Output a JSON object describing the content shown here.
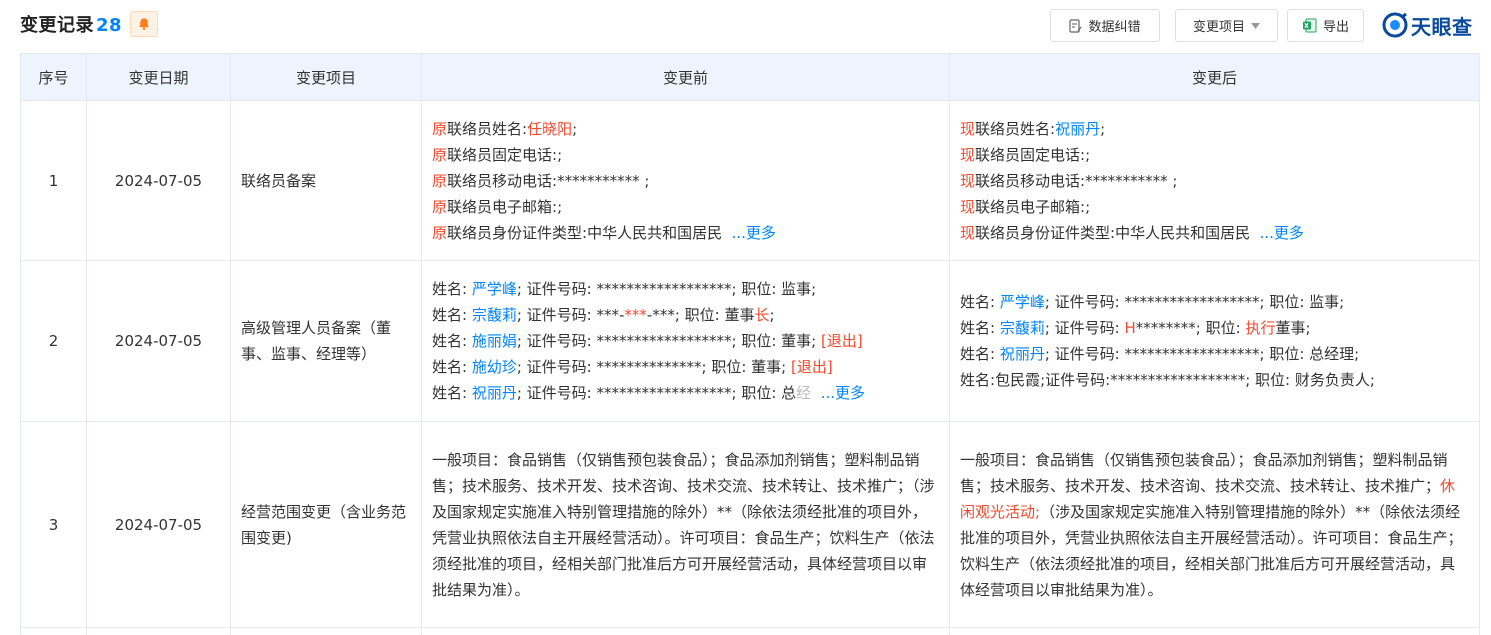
{
  "header": {
    "title": "变更记录",
    "count": "28",
    "buttons": {
      "fix": "数据纠错",
      "item": "变更项目",
      "export": "导出"
    },
    "logo_text": "天眼查"
  },
  "table": {
    "columns": [
      "序号",
      "变更日期",
      "变更项目",
      "变更前",
      "变更后"
    ],
    "rows": [
      {
        "index": "1",
        "date": "2024-07-05",
        "item": "联络员备案",
        "before": {
          "prefix": "原",
          "lines": [
            "联络员姓名:",
            "联络员固定电话:;",
            "联络员移动电话:*********** ;",
            "联络员电子邮箱:;",
            "联络员身份证件类型:中华人民共和国居民"
          ],
          "name": "任晓阳",
          "more": "...更多"
        },
        "after": {
          "prefix": "现",
          "lines": [
            "联络员姓名:",
            "联络员固定电话:;",
            "联络员移动电话:*********** ;",
            "联络员电子邮箱:;",
            "联络员身份证件类型:中华人民共和国居民"
          ],
          "name": "祝丽丹",
          "more": "...更多"
        }
      },
      {
        "index": "2",
        "date": "2024-07-05",
        "item": "高级管理人员备案（董事、监事、经理等）",
        "before": {
          "people": [
            {
              "name": "严学峰",
              "id": "******************",
              "pos": "监事",
              "tag": ""
            },
            {
              "name": "宗馥莉",
              "id": "***-***-***",
              "pos": "董事",
              "tag": ""
            },
            {
              "name": "施丽娟",
              "id": "******************",
              "pos": "董事",
              "tag": "[退出]"
            },
            {
              "name": "施幼珍",
              "id": "**************",
              "pos": "董事",
              "tag": "[退出]"
            },
            {
              "name": "祝丽丹",
              "id": "******************",
              "pos": "总经理",
              "tag": ""
            }
          ],
          "suffix_red": "长",
          "more": "...更多"
        },
        "after": {
          "people": [
            {
              "name": "严学峰",
              "id": "******************",
              "pos": "监事"
            },
            {
              "name": "宗馥莉",
              "id": "H********",
              "pos": "董事"
            },
            {
              "name": "祝丽丹",
              "id": "******************",
              "pos": "总经理"
            },
            {
              "name": "包民霞",
              "id": "******************",
              "pos": "财务负责人"
            }
          ],
          "exec_red": "执行"
        }
      },
      {
        "index": "3",
        "date": "2024-07-05",
        "item": "经营范围变更（含业务范围变更)",
        "before": "一般项目：食品销售（仅销售预包装食品）；食品添加剂销售；塑料制品销售；技术服务、技术开发、技术咨询、技术交流、技术转让、技术推广；（涉及国家规定实施准入特别管理措施的除外）**（除依法须经批准的项目外，凭营业执照依法自主开展经营活动）。许可项目：食品生产；饮料生产（依法须经批准的项目，经相关部门批准后方可开展经营活动，具体经营项目以审批结果为准）。",
        "after": {
          "part1": "一般项目：食品销售（仅销售预包装食品）；食品添加剂销售；塑料制品销售；技术服务、技术开发、技术咨询、技术交流、技术转让、技术推广；",
          "highlight": "休闲观光活动;",
          "part2": "（涉及国家规定实施准入特别管理措施的除外）**（除依法须经批准的项目外，凭营业执照依法自主开展经营活动）。许可项目：食品生产；饮料生产（依法须经批准的项目，经相关部门批准后方可开展经营活动，具体经营项目以审批结果为准）。"
        }
      }
    ]
  },
  "colors": {
    "accent": "#0084ff",
    "highlight": "#f04a2f",
    "header_bg": "#eef4fd"
  }
}
